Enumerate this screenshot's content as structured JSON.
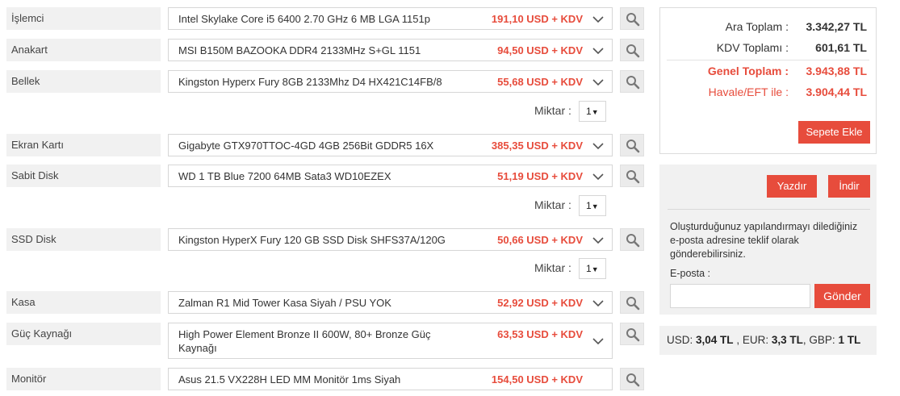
{
  "components": [
    {
      "category": "İşlemci",
      "product": "Intel Skylake Core i5 6400 2.70 GHz 6 MB LGA 1151p",
      "price": "191,10 USD + KDV"
    },
    {
      "category": "Anakart",
      "product": "MSI B150M BAZOOKA DDR4 2133MHz S+GL 1151",
      "price": "94,50 USD + KDV"
    },
    {
      "category": "Bellek",
      "product": "Kingston Hyperx Fury 8GB 2133Mhz D4 HX421C14FB/8",
      "price": "55,68 USD + KDV",
      "qty_label": "Miktar :",
      "qty": "1"
    },
    {
      "category": "Ekran Kartı",
      "product": "Gigabyte GTX970TTOC-4GD 4GB 256Bit GDDR5 16X",
      "price": "385,35 USD + KDV"
    },
    {
      "category": "Sabit Disk",
      "product": "WD 1 TB Blue 7200 64MB Sata3 WD10EZEX",
      "price": "51,19 USD + KDV",
      "qty_label": "Miktar :",
      "qty": "1"
    },
    {
      "category": "SSD Disk",
      "product": "Kingston HyperX Fury 120 GB SSD Disk SHFS37A/120G",
      "price": "50,66 USD + KDV",
      "qty_label": "Miktar :",
      "qty": "1"
    },
    {
      "category": "Kasa",
      "product": "Zalman R1 Mid Tower Kasa Siyah / PSU YOK",
      "price": "52,92 USD + KDV"
    },
    {
      "category": "Güç Kaynağı",
      "product_line1": "High Power Element Bronze II 600W, 80+ Bronze Güç",
      "product_line2": "Kaynağı",
      "price": "63,53 USD + KDV"
    },
    {
      "category": "Monitör",
      "product": "Asus 21.5 VX228H LED MM Monitör 1ms Siyah",
      "price": "154,50 USD + KDV"
    }
  ],
  "summary": {
    "subtotal_label": "Ara Toplam :",
    "subtotal": "3.342,27 TL",
    "vat_label": "KDV Toplamı :",
    "vat": "601,61 TL",
    "total_label": "Genel Toplam :",
    "total": "3.943,88 TL",
    "transfer_label": "Havale/EFT ile :",
    "transfer": "3.904,44 TL",
    "add_to_cart": "Sepete Ekle"
  },
  "actions": {
    "print": "Yazdır",
    "download": "İndir",
    "email_message": "Oluşturduğunuz yapılandırmayı dilediğiniz e-posta adresine teklif olarak gönderebilirsiniz.",
    "email_label": "E-posta :",
    "email_value": "",
    "send": "Gönder"
  },
  "rates": {
    "usd_label": "USD:",
    "usd": "3,04 TL",
    "eur_label": "EUR:",
    "eur": "3,3 TL",
    "gbp_label": "GBP:",
    "gbp": "1 TL"
  },
  "icons": {
    "search": "search-icon",
    "dropdown": "chevron-down-icon"
  },
  "colors": {
    "accent": "#e74c3c",
    "panel_bg": "#f1f1f1"
  }
}
